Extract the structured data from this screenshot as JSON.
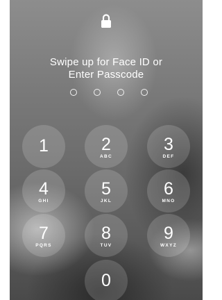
{
  "lockscreen": {
    "lock_icon": "padlock-icon",
    "prompt_line1": "Swipe up for Face ID or",
    "prompt_line2": "Enter Passcode",
    "passcode_length": 4,
    "entered_digits": 0
  },
  "keypad": {
    "keys": [
      {
        "digit": "1",
        "letters": ""
      },
      {
        "digit": "2",
        "letters": "ABC"
      },
      {
        "digit": "3",
        "letters": "DEF"
      },
      {
        "digit": "4",
        "letters": "GHI"
      },
      {
        "digit": "5",
        "letters": "JKL"
      },
      {
        "digit": "6",
        "letters": "MNO"
      },
      {
        "digit": "7",
        "letters": "PQRS"
      },
      {
        "digit": "8",
        "letters": "TUV"
      },
      {
        "digit": "9",
        "letters": "WXYZ"
      },
      {
        "digit": "0",
        "letters": ""
      }
    ]
  },
  "colors": {
    "text": "#ffffff",
    "key_fill": "rgba(255,255,255,0.16)"
  }
}
